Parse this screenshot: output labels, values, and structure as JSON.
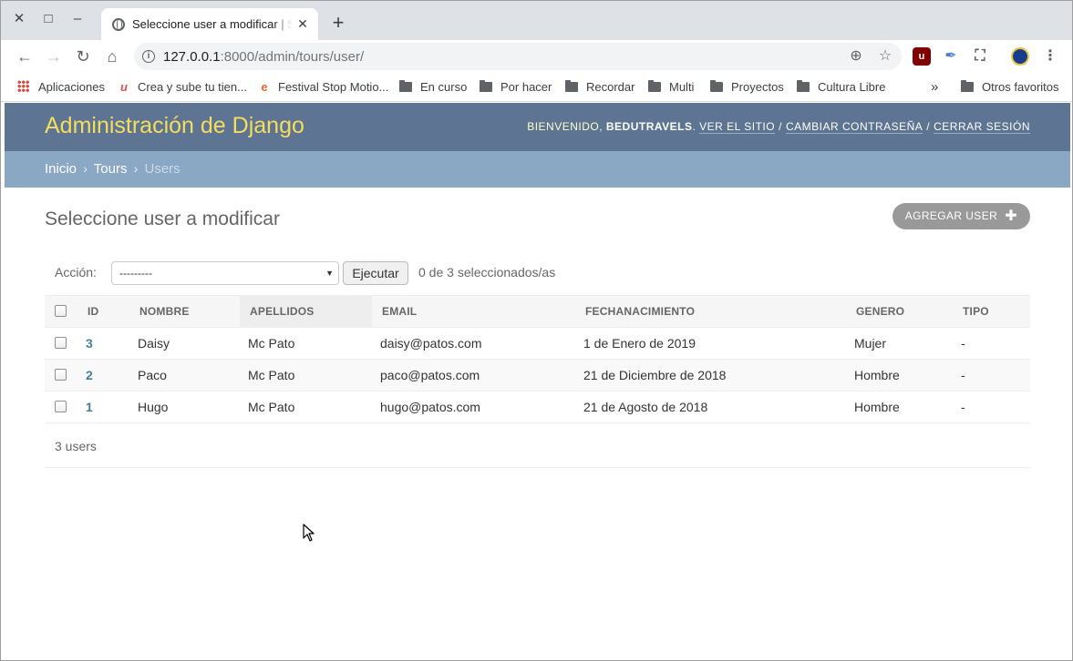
{
  "browser": {
    "tab_title": "Seleccione user a modificar | Sitio de administración de Django",
    "url_host": "127.0.0.1",
    "url_rest": ":8000/admin/tours/user/",
    "bookmarks": [
      {
        "label": "Aplicaciones",
        "icon": "apps-grid-icon"
      },
      {
        "label": "Crea y sube tu tien...",
        "icon": "u-logo-icon"
      },
      {
        "label": "Festival Stop Motio...",
        "icon": "e-logo-icon"
      },
      {
        "label": "En curso",
        "icon": "folder-icon"
      },
      {
        "label": "Por hacer",
        "icon": "folder-icon"
      },
      {
        "label": "Recordar",
        "icon": "folder-icon"
      },
      {
        "label": "Multi",
        "icon": "folder-icon"
      },
      {
        "label": "Proyectos",
        "icon": "folder-icon"
      },
      {
        "label": "Cultura Libre",
        "icon": "folder-icon"
      }
    ],
    "more_bookmarks": "»",
    "other_bookmarks": "Otros favoritos"
  },
  "header": {
    "site_name": "Administración de Django",
    "welcome": "BIENVENIDO, ",
    "username": "BEDUTRAVELS",
    "view_site": "VER EL SITIO",
    "change_password": "CAMBIAR CONTRASEÑA",
    "logout": "CERRAR SESIÓN",
    "sep": "/"
  },
  "breadcrumbs": {
    "home": "Inicio",
    "app": "Tours",
    "current": "Users",
    "arrow": "›"
  },
  "content": {
    "title": "Seleccione user a modificar",
    "add_button": "AGREGAR USER",
    "action_label": "Acción:",
    "action_value": "---------",
    "run_button": "Ejecutar",
    "selection_count": "0 de 3 seleccionados/as",
    "columns": [
      "ID",
      "NOMBRE",
      "APELLIDOS",
      "EMAIL",
      "FECHANACIMIENTO",
      "GENERO",
      "TIPO"
    ],
    "rows": [
      [
        "3",
        "Daisy",
        "Mc Pato",
        "daisy@patos.com",
        "1 de Enero de 2019",
        "Mujer",
        "-"
      ],
      [
        "2",
        "Paco",
        "Mc Pato",
        "paco@patos.com",
        "21 de Diciembre de 2018",
        "Hombre",
        "-"
      ],
      [
        "1",
        "Hugo",
        "Mc Pato",
        "hugo@patos.com",
        "21 de Agosto de 2018",
        "Hombre",
        "-"
      ]
    ],
    "paginator": "3 users"
  },
  "colors": {
    "header_bg": "#5d7593",
    "site_name": "#f5dd5d",
    "breadcrumb_bg": "#8aa7c4",
    "link": "#447e9b"
  }
}
